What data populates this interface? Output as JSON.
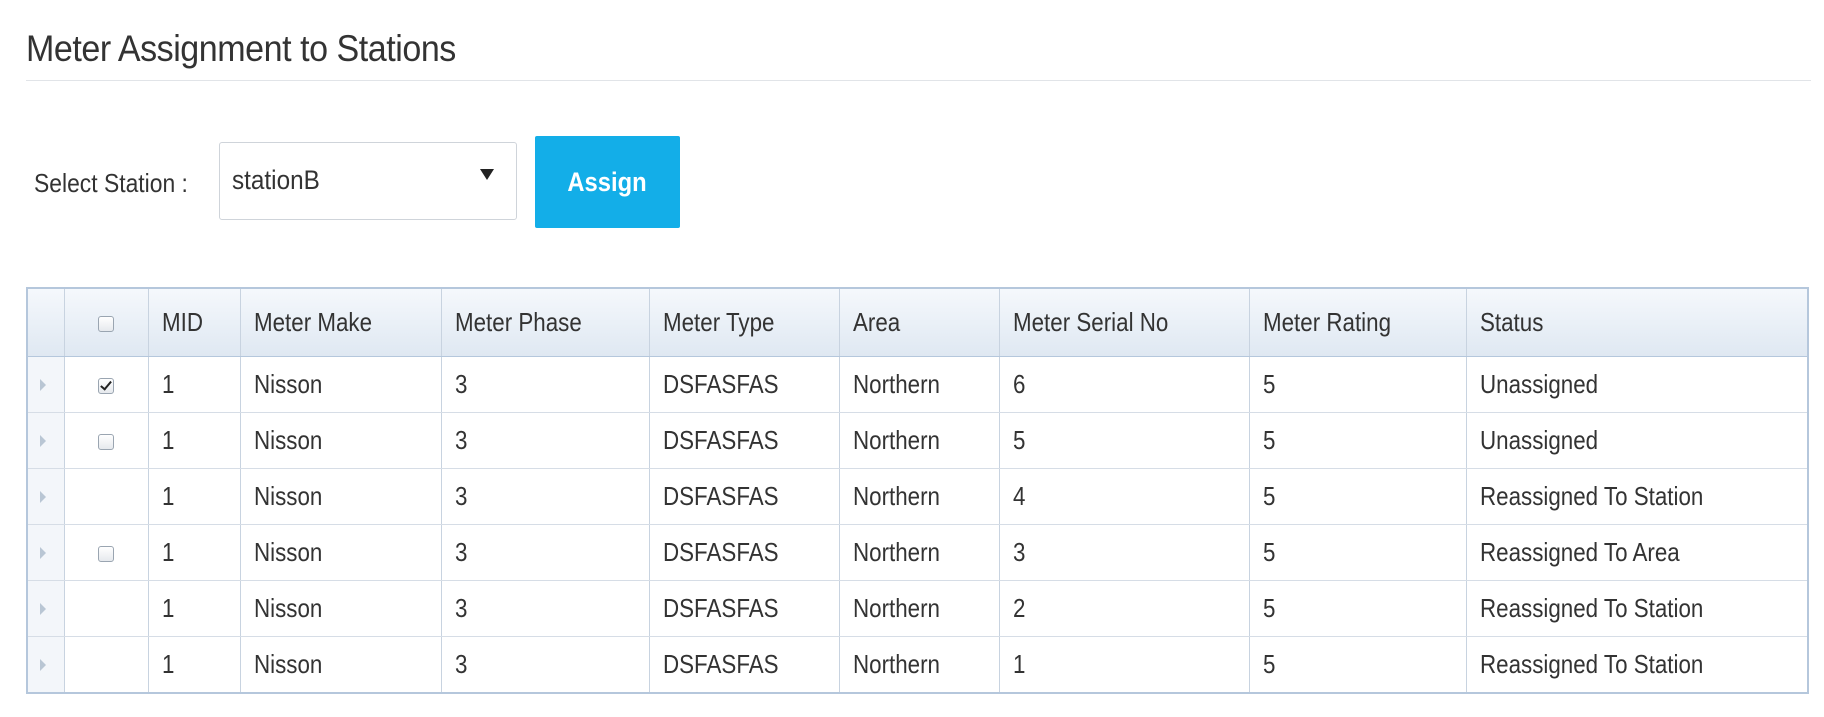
{
  "page": {
    "title": "Meter Assignment to Stations"
  },
  "station": {
    "label": "Select Station :",
    "selected": "stationB"
  },
  "actions": {
    "assign_label": "Assign"
  },
  "table": {
    "columns": [
      "MID",
      "Meter Make",
      "Meter Phase",
      "Meter Type",
      "Area",
      "Meter Serial No",
      "Meter Rating",
      "Status"
    ],
    "rows": [
      {
        "checkbox": "checked",
        "mid": "1",
        "make": "Nisson",
        "phase": "3",
        "type": "DSFASFAS",
        "area": "Northern",
        "serial": "6",
        "rating": "5",
        "status": "Unassigned"
      },
      {
        "checkbox": "unchecked",
        "mid": "1",
        "make": "Nisson",
        "phase": "3",
        "type": "DSFASFAS",
        "area": "Northern",
        "serial": "5",
        "rating": "5",
        "status": "Unassigned"
      },
      {
        "checkbox": "none",
        "mid": "1",
        "make": "Nisson",
        "phase": "3",
        "type": "DSFASFAS",
        "area": "Northern",
        "serial": "4",
        "rating": "5",
        "status": "Reassigned To Station"
      },
      {
        "checkbox": "unchecked",
        "mid": "1",
        "make": "Nisson",
        "phase": "3",
        "type": "DSFASFAS",
        "area": "Northern",
        "serial": "3",
        "rating": "5",
        "status": "Reassigned To Area"
      },
      {
        "checkbox": "none",
        "mid": "1",
        "make": "Nisson",
        "phase": "3",
        "type": "DSFASFAS",
        "area": "Northern",
        "serial": "2",
        "rating": "5",
        "status": "Reassigned To Station"
      },
      {
        "checkbox": "none",
        "mid": "1",
        "make": "Nisson",
        "phase": "3",
        "type": "DSFASFAS",
        "area": "Northern",
        "serial": "1",
        "rating": "5",
        "status": "Reassigned To Station"
      }
    ]
  },
  "colors": {
    "accent": "#13aee8",
    "grid_border": "#b5c7dc"
  },
  "icons": {
    "dropdown": "caret-down-icon",
    "row_indicator": "triangle-right-icon",
    "checkbox": "checkbox-icon"
  }
}
